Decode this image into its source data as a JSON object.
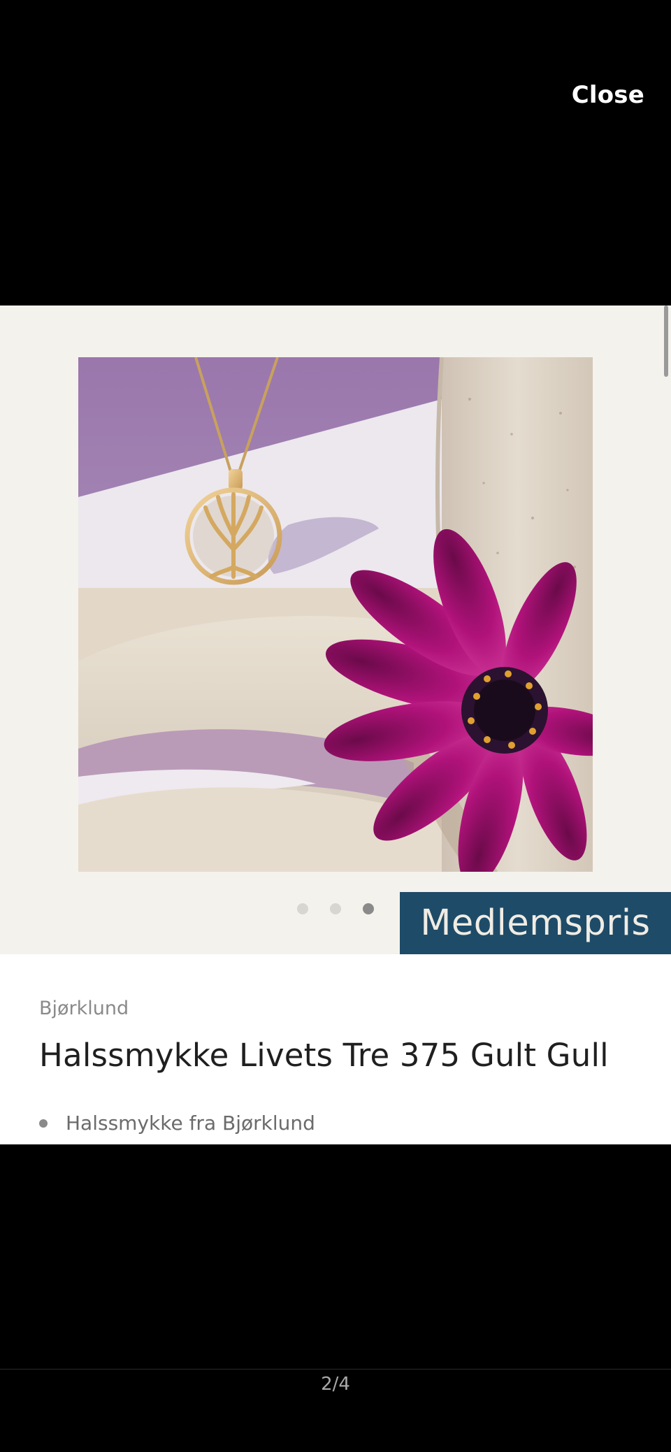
{
  "viewer": {
    "close_label": "Close",
    "counter": "2/4"
  },
  "gallery": {
    "image_alt": "Halssmykke Livets Tre 375 Gult Gull",
    "dots": {
      "total": 3,
      "active_index": 2
    },
    "badge_label": "Medlemspris",
    "badge_color": "#1e4b68"
  },
  "product": {
    "brand": "Bjørklund",
    "title": "Halssmykke Livets Tre 375 Gult Gull",
    "features": [
      "Halssmykke fra Bjørklund"
    ]
  },
  "icons": {
    "pendant": "tree-of-life-pendant-icon"
  }
}
